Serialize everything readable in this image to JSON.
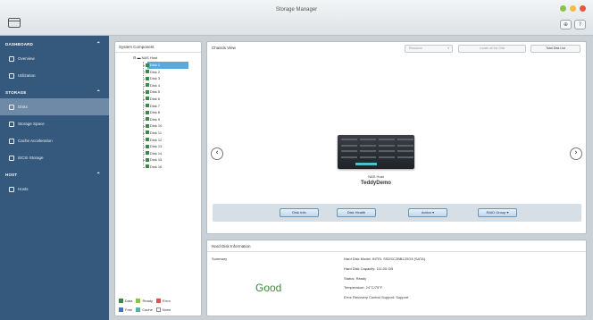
{
  "window": {
    "title": "Storage Manager"
  },
  "titlebar": {
    "dots": [
      {
        "name": "minimize-dot",
        "color": "#8cc152"
      },
      {
        "name": "maximize-dot",
        "color": "#f6bb42"
      },
      {
        "name": "close-dot",
        "color": "#e9573f"
      }
    ],
    "icons": [
      {
        "name": "refresh-icon",
        "glyph": "⊕"
      },
      {
        "name": "help-icon",
        "glyph": "?"
      }
    ]
  },
  "sidebar": {
    "sections": [
      {
        "label": "DASHBOARD",
        "items": [
          {
            "label": "Overview",
            "icon": "overview-icon"
          },
          {
            "label": "Utilization",
            "icon": "utilization-icon"
          }
        ]
      },
      {
        "label": "STORAGE",
        "items": [
          {
            "label": "Disks",
            "icon": "disks-icon",
            "active": true
          },
          {
            "label": "Storage Space",
            "icon": "storage-space-icon"
          },
          {
            "label": "Cache Acceleration",
            "icon": "cache-acceleration-icon"
          },
          {
            "label": "iSCSI Storage",
            "icon": "iscsi-storage-icon"
          }
        ]
      },
      {
        "label": "HOST",
        "items": [
          {
            "label": "Hosts",
            "icon": "hosts-icon"
          }
        ]
      }
    ]
  },
  "components": {
    "title": "System Component",
    "root": "NAS Host",
    "disks": [
      "Disk 1",
      "Disk 2",
      "Disk 3",
      "Disk 4",
      "Disk 5",
      "Disk 6",
      "Disk 7",
      "Disk 8",
      "Disk 9",
      "Disk 10",
      "Disk 11",
      "Disk 12",
      "Disk 13",
      "Disk 14",
      "Disk 15",
      "Disk 16"
    ],
    "selected_index": 0,
    "legend_row1": [
      {
        "label": "Data",
        "color": "#3a8a45"
      },
      {
        "label": "Ready",
        "color": "#8bc34a"
      },
      {
        "label": "Error",
        "color": "#d9534f"
      }
    ],
    "legend_row2": [
      {
        "label": "Free",
        "color": "#4a74b8"
      },
      {
        "label": "Cache",
        "color": "#5ab0a0"
      },
      {
        "label": "None",
        "color": "#ffffff"
      }
    ]
  },
  "chassis": {
    "title": "Chassis View",
    "resource_select": "Resource",
    "locate_button": "Locate all the Disk",
    "disk_list_button": "Total Disk List",
    "nas_label": "NAS Host",
    "nas_name": "TeddyDemo",
    "actions": [
      "Disk Info",
      "Disk Health",
      "Action ▾",
      "RAID Group ▾"
    ]
  },
  "hd_info": {
    "title": "Hard Disk Information",
    "summary_label": "Summary",
    "status_big": "Good",
    "status_color": "#3a8a3a",
    "details": [
      "Hard Disk Model: INTEL SSDSC2BB120G4 (SATA)",
      "Hard Disk Capacity: 111.00 GB",
      "Status: Ready",
      "Temperature: 24°C/75°F",
      "Error Recovery Control Support: Support"
    ]
  }
}
